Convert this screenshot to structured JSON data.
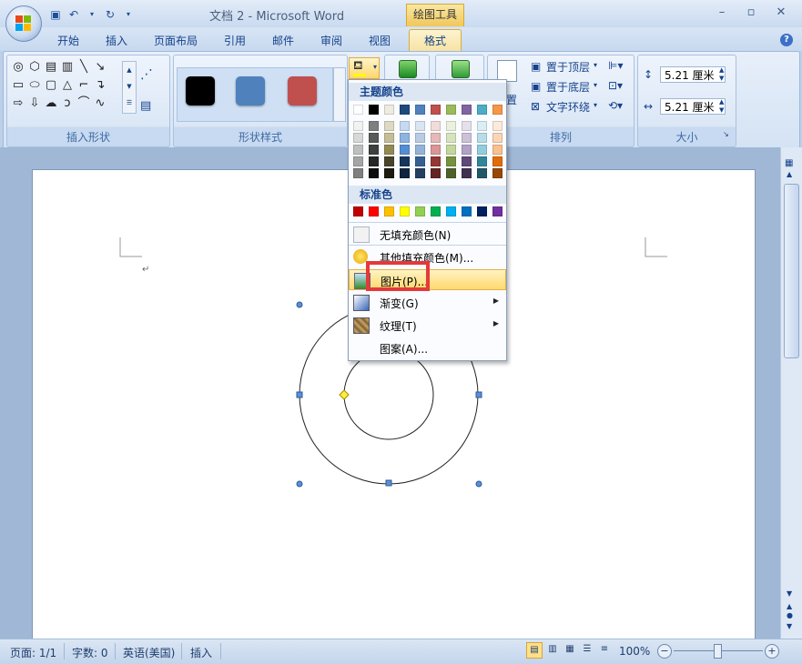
{
  "window": {
    "doc_title": "文档 2 - Microsoft Word",
    "context_tab_group": "绘图工具",
    "minimize": "–",
    "restore": "▫",
    "close": "✕"
  },
  "tabs": [
    "开始",
    "插入",
    "页面布局",
    "引用",
    "邮件",
    "审阅",
    "视图",
    "格式"
  ],
  "ribbon": {
    "groups": {
      "insert_shapes": "插入形状",
      "shape_styles": "形状样式",
      "arrange": "排列",
      "size": "大小"
    },
    "arrange": {
      "bring_front": "置于顶层",
      "send_back": "置于底层",
      "text_wrap": "文字环绕",
      "position_partial": "置"
    },
    "size": {
      "height": "5.21 厘米",
      "width": "5.21 厘米"
    },
    "style_swatch_colors": [
      "#000000",
      "#4f81bd",
      "#c0504d"
    ]
  },
  "fill_menu": {
    "theme_header": "主题颜色",
    "standard_header": "标准色",
    "theme_top_row": [
      "#ffffff",
      "#000000",
      "#eeece1",
      "#1f497d",
      "#4f81bd",
      "#c0504d",
      "#9bbb59",
      "#8064a2",
      "#4bacc6",
      "#f79646"
    ],
    "theme_shades": [
      [
        "#f2f2f2",
        "#7f7f7f",
        "#ddd9c3",
        "#c6d9f0",
        "#dbe5f1",
        "#f2dcdb",
        "#ebf1dd",
        "#e5e0ec",
        "#dbeef3",
        "#fdeada"
      ],
      [
        "#d8d8d8",
        "#595959",
        "#c4bd97",
        "#8db3e2",
        "#b8cce4",
        "#e5b9b7",
        "#d7e3bc",
        "#ccc1d9",
        "#b7dde8",
        "#fbd5b5"
      ],
      [
        "#bfbfbf",
        "#3f3f3f",
        "#938953",
        "#548dd4",
        "#95b3d7",
        "#d99694",
        "#c3d69b",
        "#b2a2c7",
        "#92cddc",
        "#fac08f"
      ],
      [
        "#a5a5a5",
        "#262626",
        "#494429",
        "#17365d",
        "#366092",
        "#953734",
        "#76923c",
        "#5f497a",
        "#31859b",
        "#e36c09"
      ],
      [
        "#7f7f7f",
        "#0c0c0c",
        "#1d1b10",
        "#0f243e",
        "#244061",
        "#632423",
        "#4f6128",
        "#3f3151",
        "#205867",
        "#974806"
      ]
    ],
    "standard_colors": [
      "#c00000",
      "#ff0000",
      "#ffc000",
      "#ffff00",
      "#92d050",
      "#00b050",
      "#00b0f0",
      "#0070c0",
      "#002060",
      "#7030a0"
    ],
    "items": {
      "no_fill": "无填充颜色(N)",
      "more_colors": "其他填充颜色(M)...",
      "picture": "图片(P)...",
      "gradient": "渐变(G)",
      "texture": "纹理(T)",
      "pattern": "图案(A)..."
    }
  },
  "status": {
    "page": "页面: 1/1",
    "words": "字数: 0",
    "language": "英语(美国)",
    "mode": "插入",
    "zoom": "100%"
  }
}
